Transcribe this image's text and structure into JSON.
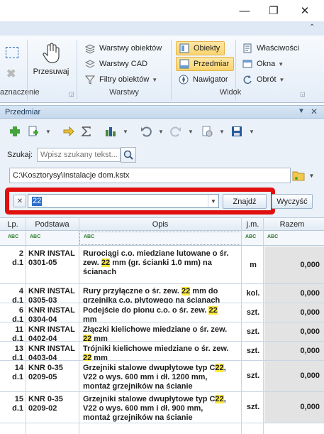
{
  "window": {
    "minimize_glyph": "—",
    "maximize_glyph": "❐",
    "close_glyph": "✕",
    "collapse_glyph": "⌃"
  },
  "ribbon": {
    "groups": [
      {
        "label": "aznaczenie"
      },
      {
        "label": "Warstwy"
      },
      {
        "label": "Widok"
      }
    ],
    "buttons": {
      "przesuwaj": "Przesuwaj",
      "warstwy_obiektow": "Warstwy obiektów",
      "warstwy_cad": "Warstwy CAD",
      "filtry_obiektow": "Filtry obiektów",
      "obiekty": "Obiekty",
      "przedmiar": "Przedmiar",
      "nawigator": "Nawigator",
      "wlasciwosci": "Właściwości",
      "okna": "Okna",
      "obrot": "Obrót"
    }
  },
  "panel": {
    "title": "Przedmiar",
    "search_label": "Szukaj:",
    "search_placeholder": "Wpisz szukany tekst...",
    "file_path": "C:\\Kosztorysy\\Instalacje dom.kstx",
    "find_value": "22",
    "find_button": "Znajdź",
    "clear_button": "Wyczyść"
  },
  "grid": {
    "columns": [
      "Lp.",
      "Podstawa",
      "Opis",
      "j.m.",
      "Razem"
    ],
    "filter_icon_text": "ABC",
    "highlight": "22",
    "rows": [
      {
        "lp": "2\nd.1",
        "podstawa": "KNR INSTAL\n0301-05",
        "opis": [
          "Rurociągi c.o. miedziane lutowane o śr.",
          "zew. [22] mm (gr. ścianki 1.0 mm) na",
          "ścianach"
        ],
        "jm": "m",
        "razem": "0,000"
      },
      {
        "lp": "4\nd.1",
        "podstawa": "KNR INSTAL\n0305-03",
        "opis": [
          "Rury przyłączne o śr. zew. [22] mm do",
          "grzejnika c.o. płytowego na ścianach"
        ],
        "jm": "kol.",
        "razem": "0,000"
      },
      {
        "lp": "6\nd.1",
        "podstawa": "KNR INSTAL\n0304-04",
        "opis": [
          "Podejście do pionu c.o. o śr. zew. [22]",
          "mm"
        ],
        "jm": "szt.",
        "razem": "0,000"
      },
      {
        "lp": "11\nd.1",
        "podstawa": "KNR INSTAL\n0402-04",
        "opis": [
          "Złączki kielichowe miedziane o śr. zew.",
          "[22] mm"
        ],
        "jm": "szt.",
        "razem": "0,000"
      },
      {
        "lp": "13\nd.1",
        "podstawa": "KNR INSTAL\n0403-04",
        "opis": [
          "Trójniki kielichowe miedziane o śr. zew.",
          "[22] mm"
        ],
        "jm": "szt.",
        "razem": "0,000"
      },
      {
        "lp": "14\nd.1",
        "podstawa": "KNR 0-35\n0209-05",
        "opis": [
          "Grzejniki stalowe dwupłytowe typ C[22],",
          "V22 o wys. 600 mm i dł. 1200 mm,",
          "montaż grzejników na ścianie"
        ],
        "jm": "szt.",
        "razem": "0,000"
      },
      {
        "lp": "15\nd.1",
        "podstawa": "KNR 0-35\n0209-02",
        "opis": [
          "Grzejniki stalowe dwupłytowe typ C[22],",
          "V22 o wys. 600 mm i dł. 900 mm,",
          "montaż grzejników na ścianie"
        ],
        "jm": "szt.",
        "razem": "0,000"
      }
    ]
  },
  "colors": {
    "highlight": "#ffe93d",
    "red_frame": "#e11010",
    "selection": "#2f6fc9"
  }
}
